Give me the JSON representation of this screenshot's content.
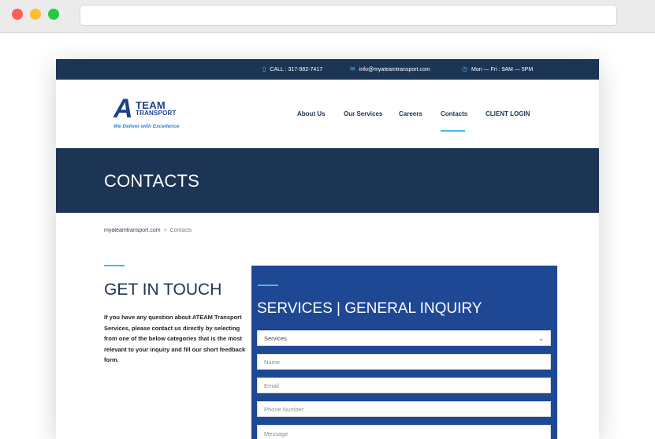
{
  "topbar": {
    "phone": "CALL : 317-982-7417",
    "email": "info@myateamtransport.com",
    "hours": "Mon — Fri : 9AM — 5PM",
    "phone_icon": "phone-icon",
    "email_icon": "envelope-icon",
    "hours_icon": "clock-icon"
  },
  "logo": {
    "a": "A",
    "team": "TEAM",
    "transport": "TRANSPORT",
    "tagline": "We Deliver with Excellence"
  },
  "nav": {
    "about": "About Us",
    "services": "Our Services",
    "careers": "Careers",
    "contacts": "Contacts",
    "login": "CLIENT LOGIN"
  },
  "hero": {
    "title": "CONTACTS"
  },
  "breadcrumb": {
    "home": "myateamtransport.com",
    "separator": ">",
    "current": "Contacts"
  },
  "get_in_touch": {
    "title": "GET IN TOUCH",
    "text": "If you have any question about ATEAM Transport Services, please contact us directly by selecting from one of the below categories that is the most relevant to your inquiry and fill our short feedback form."
  },
  "form": {
    "title": "SERVICES | GENERAL INQUIRY",
    "select_value": "Services",
    "name_placeholder": "Name",
    "email_placeholder": "Email",
    "phone_placeholder": "Phone Number",
    "message_placeholder": "Message"
  },
  "colors": {
    "navy": "#1c3555",
    "form_blue": "#1e4894",
    "accent": "#46b6e6"
  }
}
